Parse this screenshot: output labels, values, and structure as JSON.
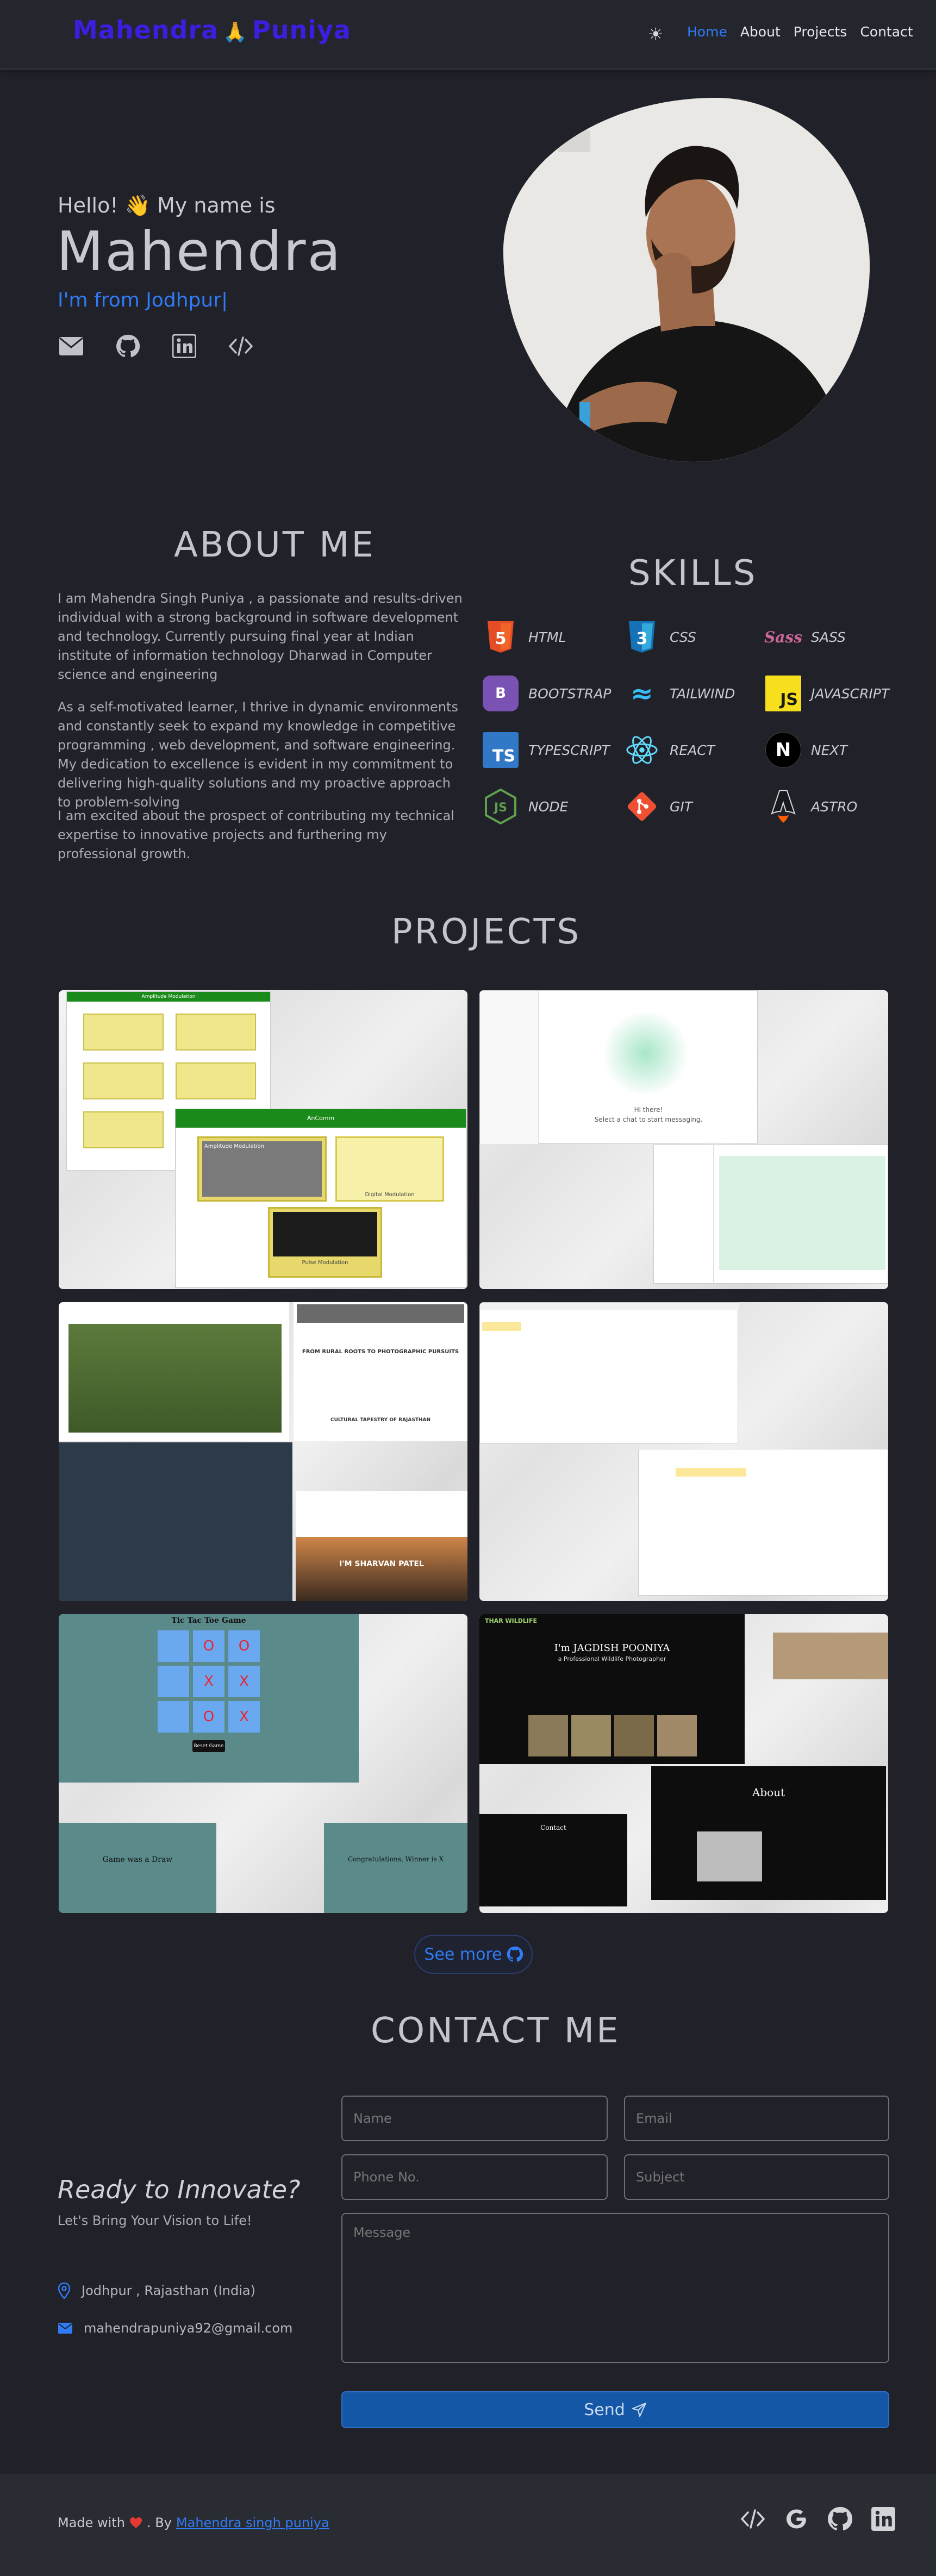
{
  "nav": {
    "logo_left": "Mahendra",
    "logo_wave": "🙏",
    "logo_right": "Puniya",
    "links": [
      "Home",
      "About",
      "Projects",
      "Contact"
    ]
  },
  "hero": {
    "greeting": "Hello! 👋 My name is",
    "name": "Mahendra",
    "from": "I'm from Jodhpur|"
  },
  "about": {
    "title": "ABOUT ME",
    "paragraphs": [
      "I am Mahendra Singh Puniya , a passionate and results-driven individual with a strong background in software development and technology. Currently pursuing final year at Indian institute of information technology Dharwad in Computer science and engineering",
      "As a self-motivated learner, I thrive in dynamic environments and constantly seek to expand my knowledge in competitive programming , web development, and software engineering. My dedication to excellence is evident in my commitment to delivering high-quality solutions and my proactive approach to problem-solving",
      "I am excited about the prospect of contributing my technical expertise to innovative projects and furthering my professional growth."
    ]
  },
  "skills": {
    "title": "SKILLS",
    "items": [
      {
        "label": "HTML",
        "badge": "5",
        "color": "#e44d26"
      },
      {
        "label": "CSS",
        "badge": "3",
        "color": "#1572b6"
      },
      {
        "label": "SASS",
        "badge": "Sass",
        "color": "#cd6799"
      },
      {
        "label": "BOOTSTRAP",
        "badge": "B",
        "color": "#7952b3"
      },
      {
        "label": "TAILWIND",
        "badge": "≈",
        "color": "#38bdf8"
      },
      {
        "label": "JAVASCRIPT",
        "badge": "JS",
        "color": "#f7df1e"
      },
      {
        "label": "TYPESCRIPT",
        "badge": "TS",
        "color": "#3178c6"
      },
      {
        "label": "REACT",
        "badge": "⚛",
        "color": "#61dafb"
      },
      {
        "label": "NEXT",
        "badge": "N",
        "color": "#000000"
      },
      {
        "label": "NODE",
        "badge": "JS",
        "color": "#5fa04e"
      },
      {
        "label": "GIT",
        "badge": "◆",
        "color": "#f05032"
      },
      {
        "label": "ASTRO",
        "badge": "▲",
        "color": "#ff5d01"
      }
    ]
  },
  "projects": {
    "title": "PROJECTS",
    "see_more": "See more",
    "shots": {
      "p1_header": "Amplitude Modulation",
      "p1_sub": "AnComm",
      "p1_box1": "Amplitude Modulation",
      "p1_box2": "Digital Modulation",
      "p1_box3": "Pulse Modulation",
      "p2_prompt": "Hi there!",
      "p2_prompt2": "Select a chat to start messaging.",
      "p3_heading": "FROM RURAL ROOTS TO PHOTOGRAPHIC PURSUITS",
      "p3_heading2": "CULTURAL TAPESTRY OF RAJASTHAN",
      "p3_name": "I'M SHARVAN PATEL",
      "p5_title": "Tic Tac Toe Game",
      "p5_cells": [
        "",
        "O",
        "O",
        "",
        "X",
        "X",
        "",
        "O",
        "X"
      ],
      "p5_reset": "Reset Game",
      "p5_draw": "Game was a Draw",
      "p5_win": "Congratulations, Winner is X",
      "p6_brand": "THAR WILDLIFE",
      "p6_hero": "I'm JAGDISH POONIYA",
      "p6_hero_sub": "a Professional Wildlife Photographer",
      "p6_about": "About",
      "p6_contact": "Contact"
    }
  },
  "contact": {
    "title": "CONTACT ME",
    "heading": "Ready to Innovate?",
    "sub": "Let's Bring Your Vision to Life!",
    "location": "Jodhpur , Rajasthan (India)",
    "email": "mahendrapuniya92@gmail.com",
    "placeholders": {
      "name": "Name",
      "email": "Email",
      "phone": "Phone No.",
      "subject": "Subject",
      "message": "Message"
    },
    "send": "Send"
  },
  "footer": {
    "made_with": "Made with",
    "by": ". By",
    "author": "Mahendra singh puniya"
  },
  "colors": {
    "accent": "#2f7cf6",
    "background": "#212229",
    "logo": "#3b1ee0",
    "send_button": "#1357a6"
  }
}
